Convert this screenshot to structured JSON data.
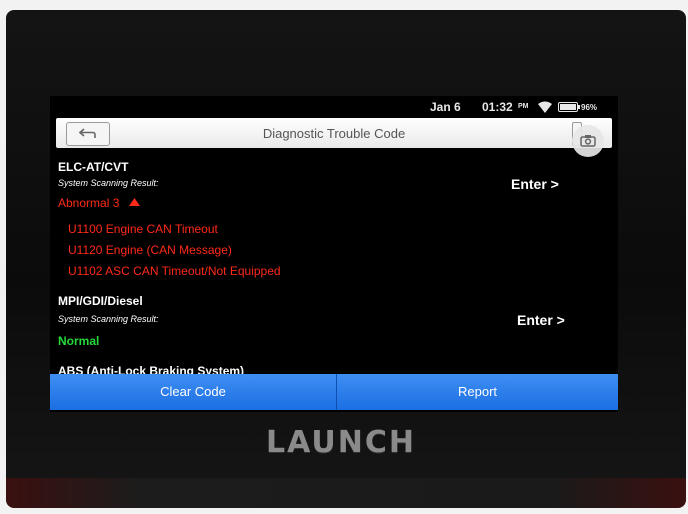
{
  "brand": "LAUNCH",
  "status_bar": {
    "date": "Jan 6",
    "time": "01:32",
    "ampm": "PM",
    "battery": "96%"
  },
  "header": {
    "title": "Diagnostic Trouble Code",
    "back_icon": "back-arrow-icon",
    "camera_icon": "camera-icon"
  },
  "modules": [
    {
      "name": "ELC-AT/CVT",
      "scan_label": "System Scanning Result:",
      "enter_label": "Enter >",
      "status": "Abnormal 3",
      "dtcs": [
        "U1100 Engine CAN Timeout",
        "U1120 Engine (CAN Message)",
        "U1102 ASC CAN Timeout/Not Equipped"
      ]
    },
    {
      "name": "MPI/GDI/Diesel",
      "scan_label": "System Scanning Result:",
      "enter_label": "Enter >",
      "status": "Normal"
    },
    {
      "name": "ABS (Anti-Lock Braking System)"
    }
  ],
  "actions": {
    "clear_code": "Clear Code",
    "report": "Report"
  },
  "colors": {
    "error": "#ff2a1a",
    "ok": "#24d83a",
    "action_bar": "#2a7ff0"
  }
}
